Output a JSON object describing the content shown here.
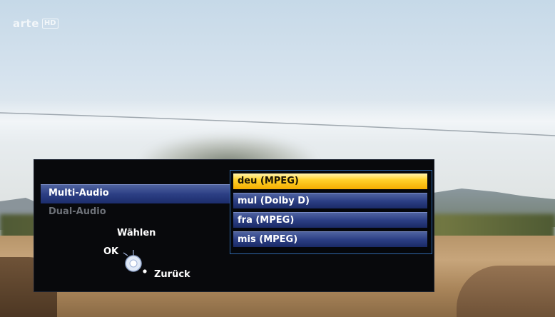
{
  "channel_logo": {
    "word": "arte",
    "badge": "HD"
  },
  "audio_menu": {
    "modes": [
      {
        "label": "Multi-Audio",
        "active": true
      },
      {
        "label": "Dual-Audio",
        "active": false
      }
    ],
    "tracks": [
      {
        "label": "deu (MPEG)",
        "selected": true
      },
      {
        "label": "mul (Dolby D)",
        "selected": false
      },
      {
        "label": "fra (MPEG)",
        "selected": false
      },
      {
        "label": "mis (MPEG)",
        "selected": false
      }
    ],
    "hints": {
      "select": "Wählen",
      "ok": "OK",
      "back": "Zurück"
    }
  },
  "colors": {
    "selection": "#ffd22c",
    "row": "#2c3f84",
    "panel": "#08090c",
    "list_border": "#2f66a8"
  },
  "icons": [
    "navigation-wheel-icon"
  ]
}
